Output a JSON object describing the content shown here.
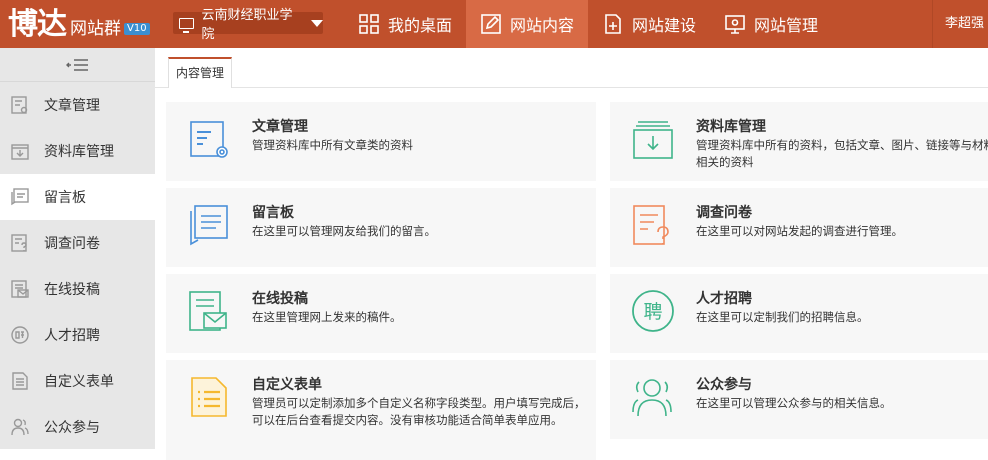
{
  "brand": {
    "name": "博达",
    "sub": "网站群",
    "version": "V10"
  },
  "site_select": {
    "value": "云南财经职业学院"
  },
  "nav": [
    {
      "label": "我的桌面",
      "icon": "grid-icon"
    },
    {
      "label": "网站内容",
      "icon": "edit-icon",
      "active": true
    },
    {
      "label": "网站建设",
      "icon": "add-page-icon"
    },
    {
      "label": "网站管理",
      "icon": "monitor-gear-icon"
    }
  ],
  "user": {
    "name": "李超强"
  },
  "sidebar": {
    "collapse_icon": "collapse-menu-icon",
    "items": [
      {
        "label": "文章管理",
        "icon": "article-icon"
      },
      {
        "label": "资料库管理",
        "icon": "download-box-icon"
      },
      {
        "label": "留言板",
        "icon": "message-icon",
        "active": true
      },
      {
        "label": "调查问卷",
        "icon": "survey-icon"
      },
      {
        "label": "在线投稿",
        "icon": "submission-icon"
      },
      {
        "label": "人才招聘",
        "icon": "recruit-icon"
      },
      {
        "label": "自定义表单",
        "icon": "form-icon"
      },
      {
        "label": "公众参与",
        "icon": "people-icon"
      }
    ]
  },
  "tab": {
    "label": "内容管理"
  },
  "cards": [
    {
      "title": "文章管理",
      "desc": "管理资料库中所有文章类的资料",
      "icon": "article-settings-icon",
      "color": "#4a90d9"
    },
    {
      "title": "资料库管理",
      "desc": "管理资料库中所有的资料，包括文章、图片、链接等与材料相关的资料",
      "icon": "library-download-icon",
      "color": "#3fb48a"
    },
    {
      "title": "留言板",
      "desc": "在这里可以管理网友给我们的留言。",
      "icon": "message-board-icon",
      "color": "#4a90d9"
    },
    {
      "title": "调查问卷",
      "desc": "在这里可以对网站发起的调查进行管理。",
      "icon": "survey-question-icon",
      "color": "#f08a5d"
    },
    {
      "title": "在线投稿",
      "desc": "在这里管理网上发来的稿件。",
      "icon": "submission-mail-icon",
      "color": "#3fb48a"
    },
    {
      "title": "人才招聘",
      "desc": "在这里可以定制我们的招聘信息。",
      "icon": "recruit-circle-icon",
      "color": "#3fb48a"
    },
    {
      "title": "自定义表单",
      "desc": "管理员可以定制添加多个自定义名称字段类型。用户填写完成后，可以在后台查看提交内容。没有审核功能适合简单表单应用。",
      "icon": "custom-form-icon",
      "color": "#f5b82e"
    },
    {
      "title": "公众参与",
      "desc": "在这里可以管理公众参与的相关信息。",
      "icon": "public-people-icon",
      "color": "#3fb48a"
    }
  ]
}
